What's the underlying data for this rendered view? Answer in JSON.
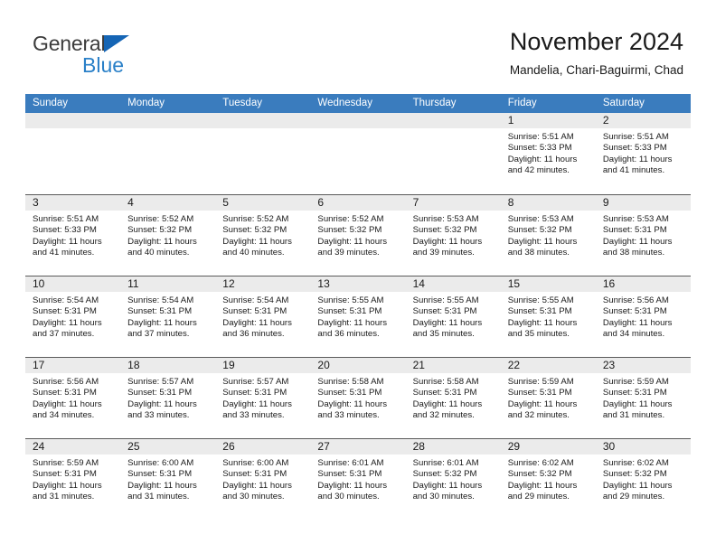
{
  "brand": {
    "name_part1": "General",
    "name_part2": "Blue",
    "triangle_color": "#1565b5",
    "blue_color": "#2a80c8"
  },
  "header": {
    "title": "November 2024",
    "subtitle": "Mandelia, Chari-Baguirmi, Chad"
  },
  "theme": {
    "header_row_bg": "#3a7cbe",
    "day_strip_bg": "#ebebeb",
    "grid_line": "#5a5a5a"
  },
  "weekdays": [
    "Sunday",
    "Monday",
    "Tuesday",
    "Wednesday",
    "Thursday",
    "Friday",
    "Saturday"
  ],
  "labels": {
    "sunrise": "Sunrise:",
    "sunset": "Sunset:",
    "daylight": "Daylight:"
  },
  "weeks": [
    [
      {
        "day": "",
        "sunrise": "",
        "sunset": "",
        "daylight_line1": "",
        "daylight_line2": "",
        "empty": true
      },
      {
        "day": "",
        "sunrise": "",
        "sunset": "",
        "daylight_line1": "",
        "daylight_line2": "",
        "empty": true
      },
      {
        "day": "",
        "sunrise": "",
        "sunset": "",
        "daylight_line1": "",
        "daylight_line2": "",
        "empty": true
      },
      {
        "day": "",
        "sunrise": "",
        "sunset": "",
        "daylight_line1": "",
        "daylight_line2": "",
        "empty": true
      },
      {
        "day": "",
        "sunrise": "",
        "sunset": "",
        "daylight_line1": "",
        "daylight_line2": "",
        "empty": true
      },
      {
        "day": "1",
        "sunrise": "Sunrise: 5:51 AM",
        "sunset": "Sunset: 5:33 PM",
        "daylight_line1": "Daylight: 11 hours",
        "daylight_line2": "and 42 minutes.",
        "empty": false
      },
      {
        "day": "2",
        "sunrise": "Sunrise: 5:51 AM",
        "sunset": "Sunset: 5:33 PM",
        "daylight_line1": "Daylight: 11 hours",
        "daylight_line2": "and 41 minutes.",
        "empty": false
      }
    ],
    [
      {
        "day": "3",
        "sunrise": "Sunrise: 5:51 AM",
        "sunset": "Sunset: 5:33 PM",
        "daylight_line1": "Daylight: 11 hours",
        "daylight_line2": "and 41 minutes.",
        "empty": false
      },
      {
        "day": "4",
        "sunrise": "Sunrise: 5:52 AM",
        "sunset": "Sunset: 5:32 PM",
        "daylight_line1": "Daylight: 11 hours",
        "daylight_line2": "and 40 minutes.",
        "empty": false
      },
      {
        "day": "5",
        "sunrise": "Sunrise: 5:52 AM",
        "sunset": "Sunset: 5:32 PM",
        "daylight_line1": "Daylight: 11 hours",
        "daylight_line2": "and 40 minutes.",
        "empty": false
      },
      {
        "day": "6",
        "sunrise": "Sunrise: 5:52 AM",
        "sunset": "Sunset: 5:32 PM",
        "daylight_line1": "Daylight: 11 hours",
        "daylight_line2": "and 39 minutes.",
        "empty": false
      },
      {
        "day": "7",
        "sunrise": "Sunrise: 5:53 AM",
        "sunset": "Sunset: 5:32 PM",
        "daylight_line1": "Daylight: 11 hours",
        "daylight_line2": "and 39 minutes.",
        "empty": false
      },
      {
        "day": "8",
        "sunrise": "Sunrise: 5:53 AM",
        "sunset": "Sunset: 5:32 PM",
        "daylight_line1": "Daylight: 11 hours",
        "daylight_line2": "and 38 minutes.",
        "empty": false
      },
      {
        "day": "9",
        "sunrise": "Sunrise: 5:53 AM",
        "sunset": "Sunset: 5:31 PM",
        "daylight_line1": "Daylight: 11 hours",
        "daylight_line2": "and 38 minutes.",
        "empty": false
      }
    ],
    [
      {
        "day": "10",
        "sunrise": "Sunrise: 5:54 AM",
        "sunset": "Sunset: 5:31 PM",
        "daylight_line1": "Daylight: 11 hours",
        "daylight_line2": "and 37 minutes.",
        "empty": false
      },
      {
        "day": "11",
        "sunrise": "Sunrise: 5:54 AM",
        "sunset": "Sunset: 5:31 PM",
        "daylight_line1": "Daylight: 11 hours",
        "daylight_line2": "and 37 minutes.",
        "empty": false
      },
      {
        "day": "12",
        "sunrise": "Sunrise: 5:54 AM",
        "sunset": "Sunset: 5:31 PM",
        "daylight_line1": "Daylight: 11 hours",
        "daylight_line2": "and 36 minutes.",
        "empty": false
      },
      {
        "day": "13",
        "sunrise": "Sunrise: 5:55 AM",
        "sunset": "Sunset: 5:31 PM",
        "daylight_line1": "Daylight: 11 hours",
        "daylight_line2": "and 36 minutes.",
        "empty": false
      },
      {
        "day": "14",
        "sunrise": "Sunrise: 5:55 AM",
        "sunset": "Sunset: 5:31 PM",
        "daylight_line1": "Daylight: 11 hours",
        "daylight_line2": "and 35 minutes.",
        "empty": false
      },
      {
        "day": "15",
        "sunrise": "Sunrise: 5:55 AM",
        "sunset": "Sunset: 5:31 PM",
        "daylight_line1": "Daylight: 11 hours",
        "daylight_line2": "and 35 minutes.",
        "empty": false
      },
      {
        "day": "16",
        "sunrise": "Sunrise: 5:56 AM",
        "sunset": "Sunset: 5:31 PM",
        "daylight_line1": "Daylight: 11 hours",
        "daylight_line2": "and 34 minutes.",
        "empty": false
      }
    ],
    [
      {
        "day": "17",
        "sunrise": "Sunrise: 5:56 AM",
        "sunset": "Sunset: 5:31 PM",
        "daylight_line1": "Daylight: 11 hours",
        "daylight_line2": "and 34 minutes.",
        "empty": false
      },
      {
        "day": "18",
        "sunrise": "Sunrise: 5:57 AM",
        "sunset": "Sunset: 5:31 PM",
        "daylight_line1": "Daylight: 11 hours",
        "daylight_line2": "and 33 minutes.",
        "empty": false
      },
      {
        "day": "19",
        "sunrise": "Sunrise: 5:57 AM",
        "sunset": "Sunset: 5:31 PM",
        "daylight_line1": "Daylight: 11 hours",
        "daylight_line2": "and 33 minutes.",
        "empty": false
      },
      {
        "day": "20",
        "sunrise": "Sunrise: 5:58 AM",
        "sunset": "Sunset: 5:31 PM",
        "daylight_line1": "Daylight: 11 hours",
        "daylight_line2": "and 33 minutes.",
        "empty": false
      },
      {
        "day": "21",
        "sunrise": "Sunrise: 5:58 AM",
        "sunset": "Sunset: 5:31 PM",
        "daylight_line1": "Daylight: 11 hours",
        "daylight_line2": "and 32 minutes.",
        "empty": false
      },
      {
        "day": "22",
        "sunrise": "Sunrise: 5:59 AM",
        "sunset": "Sunset: 5:31 PM",
        "daylight_line1": "Daylight: 11 hours",
        "daylight_line2": "and 32 minutes.",
        "empty": false
      },
      {
        "day": "23",
        "sunrise": "Sunrise: 5:59 AM",
        "sunset": "Sunset: 5:31 PM",
        "daylight_line1": "Daylight: 11 hours",
        "daylight_line2": "and 31 minutes.",
        "empty": false
      }
    ],
    [
      {
        "day": "24",
        "sunrise": "Sunrise: 5:59 AM",
        "sunset": "Sunset: 5:31 PM",
        "daylight_line1": "Daylight: 11 hours",
        "daylight_line2": "and 31 minutes.",
        "empty": false
      },
      {
        "day": "25",
        "sunrise": "Sunrise: 6:00 AM",
        "sunset": "Sunset: 5:31 PM",
        "daylight_line1": "Daylight: 11 hours",
        "daylight_line2": "and 31 minutes.",
        "empty": false
      },
      {
        "day": "26",
        "sunrise": "Sunrise: 6:00 AM",
        "sunset": "Sunset: 5:31 PM",
        "daylight_line1": "Daylight: 11 hours",
        "daylight_line2": "and 30 minutes.",
        "empty": false
      },
      {
        "day": "27",
        "sunrise": "Sunrise: 6:01 AM",
        "sunset": "Sunset: 5:31 PM",
        "daylight_line1": "Daylight: 11 hours",
        "daylight_line2": "and 30 minutes.",
        "empty": false
      },
      {
        "day": "28",
        "sunrise": "Sunrise: 6:01 AM",
        "sunset": "Sunset: 5:32 PM",
        "daylight_line1": "Daylight: 11 hours",
        "daylight_line2": "and 30 minutes.",
        "empty": false
      },
      {
        "day": "29",
        "sunrise": "Sunrise: 6:02 AM",
        "sunset": "Sunset: 5:32 PM",
        "daylight_line1": "Daylight: 11 hours",
        "daylight_line2": "and 29 minutes.",
        "empty": false
      },
      {
        "day": "30",
        "sunrise": "Sunrise: 6:02 AM",
        "sunset": "Sunset: 5:32 PM",
        "daylight_line1": "Daylight: 11 hours",
        "daylight_line2": "and 29 minutes.",
        "empty": false
      }
    ]
  ]
}
